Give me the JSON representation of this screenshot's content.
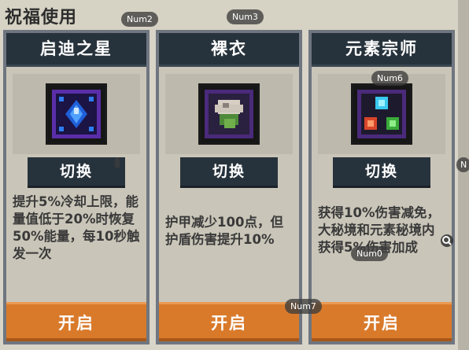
{
  "title": "祝福使用",
  "cards": [
    {
      "name": "启迪之星",
      "icon": "blue-star-gem-icon",
      "switch_label": "切换",
      "description": "提升5%冷却上限，能量值低于20%时恢复50%能量，每10秒触发一次",
      "open_label": "开启"
    },
    {
      "name": "裸衣",
      "icon": "white-flower-icon",
      "switch_label": "切换",
      "description": "护甲减少100点，但护盾伤害提升10%",
      "open_label": "开启"
    },
    {
      "name": "元素宗师",
      "icon": "elemental-orbs-icon",
      "switch_label": "切换",
      "description": "获得10%伤害减免，大秘境和元素秘境内获得5%伤害加成",
      "open_label": "开启"
    }
  ],
  "tags": {
    "num0": "Num0",
    "num2": "Num2",
    "num3": "Num3",
    "num6": "Num6",
    "num7": "Num7",
    "n": "N"
  },
  "colors": {
    "header": "#27333c",
    "open_button": "#d97a2b",
    "card_border": "#6f7680",
    "card_body": "#c9c5b8"
  }
}
